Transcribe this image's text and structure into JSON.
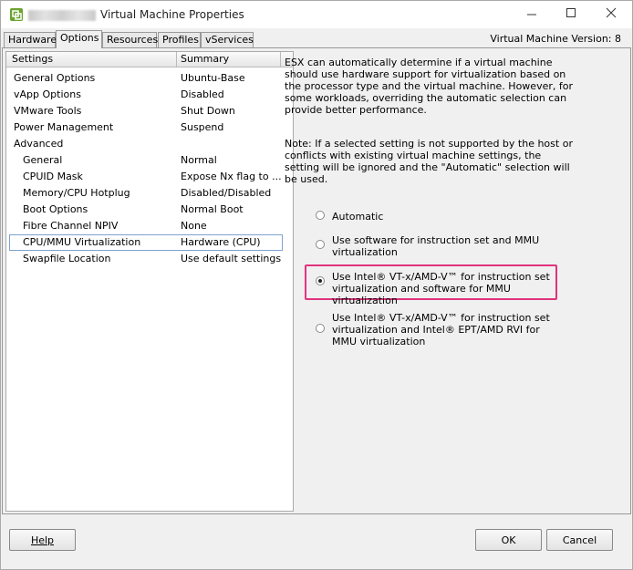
{
  "window": {
    "title": "Virtual Machine Properties",
    "controls": {
      "minimize": "minimize-icon",
      "maximize": "maximize-icon",
      "close": "close-icon"
    }
  },
  "tabs": [
    {
      "label": "Hardware",
      "active": false
    },
    {
      "label": "Options",
      "active": true
    },
    {
      "label": "Resources",
      "active": false
    },
    {
      "label": "Profiles",
      "active": false
    },
    {
      "label": "vServices",
      "active": false
    }
  ],
  "vm_version": "Virtual Machine Version: 8",
  "settings_table": {
    "headers": {
      "settings": "Settings",
      "summary": "Summary"
    },
    "rows": [
      {
        "setting": "General Options",
        "summary": "Ubuntu-Base",
        "indent": false
      },
      {
        "setting": "vApp Options",
        "summary": "Disabled",
        "indent": false
      },
      {
        "setting": "VMware Tools",
        "summary": "Shut Down",
        "indent": false
      },
      {
        "setting": "Power Management",
        "summary": "Suspend",
        "indent": false
      },
      {
        "setting": "Advanced",
        "summary": "",
        "indent": false
      },
      {
        "setting": "General",
        "summary": "Normal",
        "indent": true
      },
      {
        "setting": "CPUID Mask",
        "summary": "Expose Nx flag to ...",
        "indent": true
      },
      {
        "setting": "Memory/CPU Hotplug",
        "summary": "Disabled/Disabled",
        "indent": true
      },
      {
        "setting": "Boot Options",
        "summary": "Normal Boot",
        "indent": true
      },
      {
        "setting": "Fibre Channel NPIV",
        "summary": "None",
        "indent": true
      },
      {
        "setting": "CPU/MMU Virtualization",
        "summary": "Hardware (CPU)",
        "indent": true,
        "selected": true
      },
      {
        "setting": "Swapfile Location",
        "summary": "Use default settings",
        "indent": true
      }
    ]
  },
  "detail": {
    "description": "ESX can automatically determine if a virtual machine should use hardware support for virtualization based on the processor type and the virtual machine. However, for some workloads, overriding the automatic selection can provide better performance.",
    "note": "Note: If a selected setting is not supported by the host or conflicts with existing virtual machine settings, the setting will be ignored and the \"Automatic\" selection will be used.",
    "options": [
      {
        "label": "Automatic",
        "selected": false
      },
      {
        "label": "Use software for instruction set and MMU virtualization",
        "selected": false
      },
      {
        "label": "Use Intel® VT-x/AMD-V™ for instruction set virtualization and software for MMU virtualization",
        "selected": true
      },
      {
        "label": "Use Intel® VT-x/AMD-V™ for instruction set virtualization and Intel® EPT/AMD RVI for MMU virtualization",
        "selected": false
      }
    ],
    "highlight_color": "#e0337e"
  },
  "buttons": {
    "help": "Help",
    "ok": "OK",
    "cancel": "Cancel"
  }
}
